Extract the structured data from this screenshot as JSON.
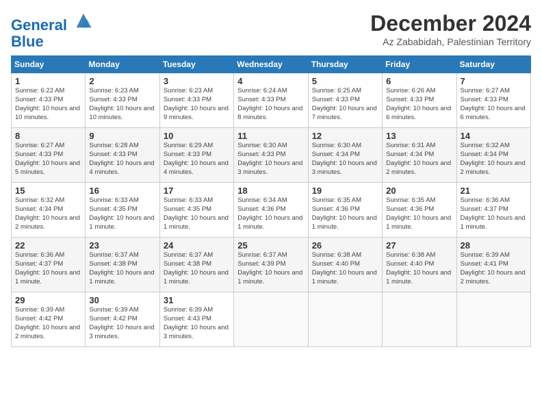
{
  "logo": {
    "line1": "General",
    "line2": "Blue"
  },
  "title": "December 2024",
  "location": "Az Zababidah, Palestinian Territory",
  "days_header": [
    "Sunday",
    "Monday",
    "Tuesday",
    "Wednesday",
    "Thursday",
    "Friday",
    "Saturday"
  ],
  "weeks": [
    [
      {
        "day": "1",
        "sunrise": "6:22 AM",
        "sunset": "4:33 PM",
        "daylight": "10 hours and 10 minutes."
      },
      {
        "day": "2",
        "sunrise": "6:23 AM",
        "sunset": "4:33 PM",
        "daylight": "10 hours and 10 minutes."
      },
      {
        "day": "3",
        "sunrise": "6:23 AM",
        "sunset": "4:33 PM",
        "daylight": "10 hours and 9 minutes."
      },
      {
        "day": "4",
        "sunrise": "6:24 AM",
        "sunset": "4:33 PM",
        "daylight": "10 hours and 8 minutes."
      },
      {
        "day": "5",
        "sunrise": "6:25 AM",
        "sunset": "4:33 PM",
        "daylight": "10 hours and 7 minutes."
      },
      {
        "day": "6",
        "sunrise": "6:26 AM",
        "sunset": "4:33 PM",
        "daylight": "10 hours and 6 minutes."
      },
      {
        "day": "7",
        "sunrise": "6:27 AM",
        "sunset": "4:33 PM",
        "daylight": "10 hours and 6 minutes."
      }
    ],
    [
      {
        "day": "8",
        "sunrise": "6:27 AM",
        "sunset": "4:33 PM",
        "daylight": "10 hours and 5 minutes."
      },
      {
        "day": "9",
        "sunrise": "6:28 AM",
        "sunset": "4:33 PM",
        "daylight": "10 hours and 4 minutes."
      },
      {
        "day": "10",
        "sunrise": "6:29 AM",
        "sunset": "4:33 PM",
        "daylight": "10 hours and 4 minutes."
      },
      {
        "day": "11",
        "sunrise": "6:30 AM",
        "sunset": "4:33 PM",
        "daylight": "10 hours and 3 minutes."
      },
      {
        "day": "12",
        "sunrise": "6:30 AM",
        "sunset": "4:34 PM",
        "daylight": "10 hours and 3 minutes."
      },
      {
        "day": "13",
        "sunrise": "6:31 AM",
        "sunset": "4:34 PM",
        "daylight": "10 hours and 2 minutes."
      },
      {
        "day": "14",
        "sunrise": "6:32 AM",
        "sunset": "4:34 PM",
        "daylight": "10 hours and 2 minutes."
      }
    ],
    [
      {
        "day": "15",
        "sunrise": "6:32 AM",
        "sunset": "4:34 PM",
        "daylight": "10 hours and 2 minutes."
      },
      {
        "day": "16",
        "sunrise": "6:33 AM",
        "sunset": "4:35 PM",
        "daylight": "10 hours and 1 minute."
      },
      {
        "day": "17",
        "sunrise": "6:33 AM",
        "sunset": "4:35 PM",
        "daylight": "10 hours and 1 minute."
      },
      {
        "day": "18",
        "sunrise": "6:34 AM",
        "sunset": "4:36 PM",
        "daylight": "10 hours and 1 minute."
      },
      {
        "day": "19",
        "sunrise": "6:35 AM",
        "sunset": "4:36 PM",
        "daylight": "10 hours and 1 minute."
      },
      {
        "day": "20",
        "sunrise": "6:35 AM",
        "sunset": "4:36 PM",
        "daylight": "10 hours and 1 minute."
      },
      {
        "day": "21",
        "sunrise": "6:36 AM",
        "sunset": "4:37 PM",
        "daylight": "10 hours and 1 minute."
      }
    ],
    [
      {
        "day": "22",
        "sunrise": "6:36 AM",
        "sunset": "4:37 PM",
        "daylight": "10 hours and 1 minute."
      },
      {
        "day": "23",
        "sunrise": "6:37 AM",
        "sunset": "4:38 PM",
        "daylight": "10 hours and 1 minute."
      },
      {
        "day": "24",
        "sunrise": "6:37 AM",
        "sunset": "4:38 PM",
        "daylight": "10 hours and 1 minute."
      },
      {
        "day": "25",
        "sunrise": "6:37 AM",
        "sunset": "4:39 PM",
        "daylight": "10 hours and 1 minute."
      },
      {
        "day": "26",
        "sunrise": "6:38 AM",
        "sunset": "4:40 PM",
        "daylight": "10 hours and 1 minute."
      },
      {
        "day": "27",
        "sunrise": "6:38 AM",
        "sunset": "4:40 PM",
        "daylight": "10 hours and 1 minute."
      },
      {
        "day": "28",
        "sunrise": "6:39 AM",
        "sunset": "4:41 PM",
        "daylight": "10 hours and 2 minutes."
      }
    ],
    [
      {
        "day": "29",
        "sunrise": "6:39 AM",
        "sunset": "4:42 PM",
        "daylight": "10 hours and 2 minutes."
      },
      {
        "day": "30",
        "sunrise": "6:39 AM",
        "sunset": "4:42 PM",
        "daylight": "10 hours and 3 minutes."
      },
      {
        "day": "31",
        "sunrise": "6:39 AM",
        "sunset": "4:43 PM",
        "daylight": "10 hours and 3 minutes."
      },
      null,
      null,
      null,
      null
    ]
  ]
}
